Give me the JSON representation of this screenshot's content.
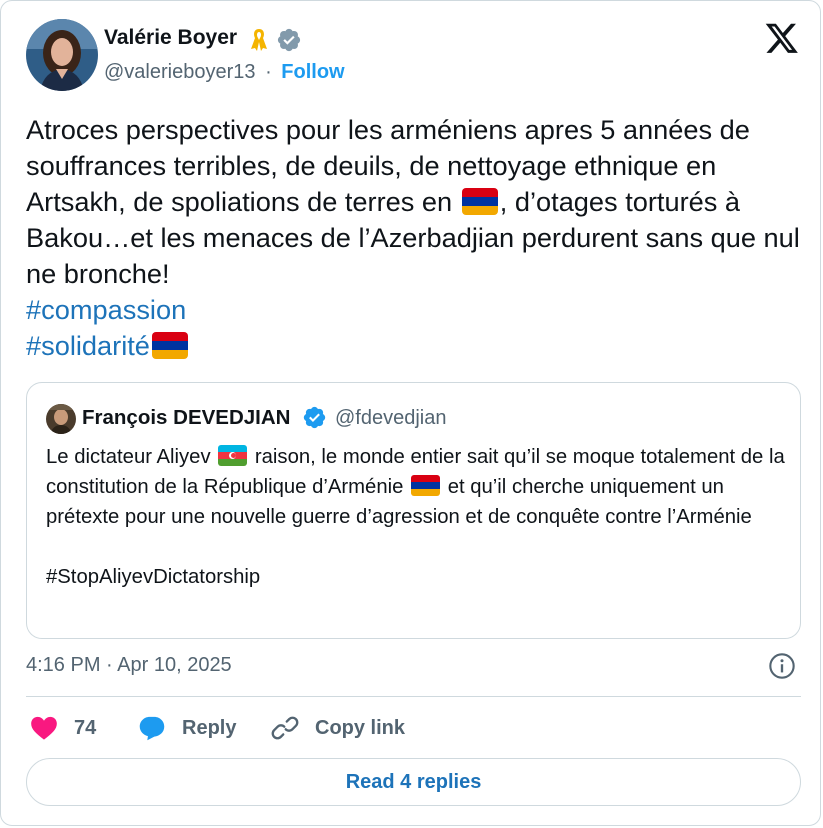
{
  "author": {
    "name": "Valérie Boyer",
    "handle": "@valerieboyer13",
    "separator": "·",
    "follow_label": "Follow",
    "badge_icons": [
      "ribbon-icon",
      "verified-badge-icon"
    ]
  },
  "platform_logo": "x-logo-icon",
  "tweet": {
    "text_part1": "Atroces perspectives pour les arméniens apres 5 années de souffrances terribles, de deuils, de nettoyage ethnique en Artsakh, de spoliations de terres en",
    "text_part2": ", d’otages torturés à Bakou…et les menaces de l’Azerbadjian perdurent sans que nul ne bronche!",
    "hashtag1": "#compassion",
    "hashtag2": "#solidarité",
    "flag_icon": "armenia-flag-icon"
  },
  "quoted_tweet": {
    "name": "François DEVEDJIAN",
    "handle": "@fdevedjian",
    "text_part1": "Le dictateur Aliyev",
    "text_part2": "raison, le monde entier sait qu’il se moque totalement de la constitution de la République d’Arménie",
    "text_part3": "et qu’il cherche uniquement un prétexte pour une nouvelle guerre d’agression et de conquête contre l’Arménie",
    "hashtag": "#StopAliyevDictatorship",
    "flag_icons": [
      "azerbaijan-flag-icon",
      "armenia-flag-icon"
    ]
  },
  "meta": {
    "timestamp": "4:16 PM · Apr 10, 2025"
  },
  "actions": {
    "like_count": "74",
    "reply_label": "Reply",
    "copy_label": "Copy link"
  },
  "read_replies_label": "Read 4 replies",
  "colors": {
    "link_blue": "#1d9bf0",
    "hashtag_blue": "#1d73b9",
    "heart_pink": "#f91880",
    "reply_blue": "#1d9bf0",
    "muted_text": "#536471",
    "border": "#cfd9de"
  }
}
